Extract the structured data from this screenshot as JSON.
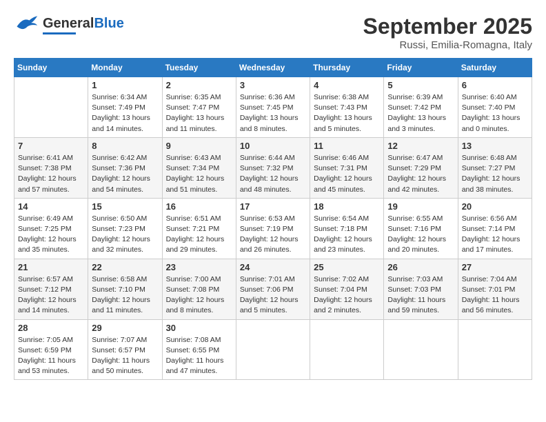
{
  "header": {
    "logo_general": "General",
    "logo_blue": "Blue",
    "month_title": "September 2025",
    "subtitle": "Russi, Emilia-Romagna, Italy"
  },
  "calendar": {
    "days_of_week": [
      "Sunday",
      "Monday",
      "Tuesday",
      "Wednesday",
      "Thursday",
      "Friday",
      "Saturday"
    ],
    "weeks": [
      [
        {
          "day": "",
          "info": ""
        },
        {
          "day": "1",
          "info": "Sunrise: 6:34 AM\nSunset: 7:49 PM\nDaylight: 13 hours\nand 14 minutes."
        },
        {
          "day": "2",
          "info": "Sunrise: 6:35 AM\nSunset: 7:47 PM\nDaylight: 13 hours\nand 11 minutes."
        },
        {
          "day": "3",
          "info": "Sunrise: 6:36 AM\nSunset: 7:45 PM\nDaylight: 13 hours\nand 8 minutes."
        },
        {
          "day": "4",
          "info": "Sunrise: 6:38 AM\nSunset: 7:43 PM\nDaylight: 13 hours\nand 5 minutes."
        },
        {
          "day": "5",
          "info": "Sunrise: 6:39 AM\nSunset: 7:42 PM\nDaylight: 13 hours\nand 3 minutes."
        },
        {
          "day": "6",
          "info": "Sunrise: 6:40 AM\nSunset: 7:40 PM\nDaylight: 13 hours\nand 0 minutes."
        }
      ],
      [
        {
          "day": "7",
          "info": "Sunrise: 6:41 AM\nSunset: 7:38 PM\nDaylight: 12 hours\nand 57 minutes."
        },
        {
          "day": "8",
          "info": "Sunrise: 6:42 AM\nSunset: 7:36 PM\nDaylight: 12 hours\nand 54 minutes."
        },
        {
          "day": "9",
          "info": "Sunrise: 6:43 AM\nSunset: 7:34 PM\nDaylight: 12 hours\nand 51 minutes."
        },
        {
          "day": "10",
          "info": "Sunrise: 6:44 AM\nSunset: 7:32 PM\nDaylight: 12 hours\nand 48 minutes."
        },
        {
          "day": "11",
          "info": "Sunrise: 6:46 AM\nSunset: 7:31 PM\nDaylight: 12 hours\nand 45 minutes."
        },
        {
          "day": "12",
          "info": "Sunrise: 6:47 AM\nSunset: 7:29 PM\nDaylight: 12 hours\nand 42 minutes."
        },
        {
          "day": "13",
          "info": "Sunrise: 6:48 AM\nSunset: 7:27 PM\nDaylight: 12 hours\nand 38 minutes."
        }
      ],
      [
        {
          "day": "14",
          "info": "Sunrise: 6:49 AM\nSunset: 7:25 PM\nDaylight: 12 hours\nand 35 minutes."
        },
        {
          "day": "15",
          "info": "Sunrise: 6:50 AM\nSunset: 7:23 PM\nDaylight: 12 hours\nand 32 minutes."
        },
        {
          "day": "16",
          "info": "Sunrise: 6:51 AM\nSunset: 7:21 PM\nDaylight: 12 hours\nand 29 minutes."
        },
        {
          "day": "17",
          "info": "Sunrise: 6:53 AM\nSunset: 7:19 PM\nDaylight: 12 hours\nand 26 minutes."
        },
        {
          "day": "18",
          "info": "Sunrise: 6:54 AM\nSunset: 7:18 PM\nDaylight: 12 hours\nand 23 minutes."
        },
        {
          "day": "19",
          "info": "Sunrise: 6:55 AM\nSunset: 7:16 PM\nDaylight: 12 hours\nand 20 minutes."
        },
        {
          "day": "20",
          "info": "Sunrise: 6:56 AM\nSunset: 7:14 PM\nDaylight: 12 hours\nand 17 minutes."
        }
      ],
      [
        {
          "day": "21",
          "info": "Sunrise: 6:57 AM\nSunset: 7:12 PM\nDaylight: 12 hours\nand 14 minutes."
        },
        {
          "day": "22",
          "info": "Sunrise: 6:58 AM\nSunset: 7:10 PM\nDaylight: 12 hours\nand 11 minutes."
        },
        {
          "day": "23",
          "info": "Sunrise: 7:00 AM\nSunset: 7:08 PM\nDaylight: 12 hours\nand 8 minutes."
        },
        {
          "day": "24",
          "info": "Sunrise: 7:01 AM\nSunset: 7:06 PM\nDaylight: 12 hours\nand 5 minutes."
        },
        {
          "day": "25",
          "info": "Sunrise: 7:02 AM\nSunset: 7:04 PM\nDaylight: 12 hours\nand 2 minutes."
        },
        {
          "day": "26",
          "info": "Sunrise: 7:03 AM\nSunset: 7:03 PM\nDaylight: 11 hours\nand 59 minutes."
        },
        {
          "day": "27",
          "info": "Sunrise: 7:04 AM\nSunset: 7:01 PM\nDaylight: 11 hours\nand 56 minutes."
        }
      ],
      [
        {
          "day": "28",
          "info": "Sunrise: 7:05 AM\nSunset: 6:59 PM\nDaylight: 11 hours\nand 53 minutes."
        },
        {
          "day": "29",
          "info": "Sunrise: 7:07 AM\nSunset: 6:57 PM\nDaylight: 11 hours\nand 50 minutes."
        },
        {
          "day": "30",
          "info": "Sunrise: 7:08 AM\nSunset: 6:55 PM\nDaylight: 11 hours\nand 47 minutes."
        },
        {
          "day": "",
          "info": ""
        },
        {
          "day": "",
          "info": ""
        },
        {
          "day": "",
          "info": ""
        },
        {
          "day": "",
          "info": ""
        }
      ]
    ]
  }
}
